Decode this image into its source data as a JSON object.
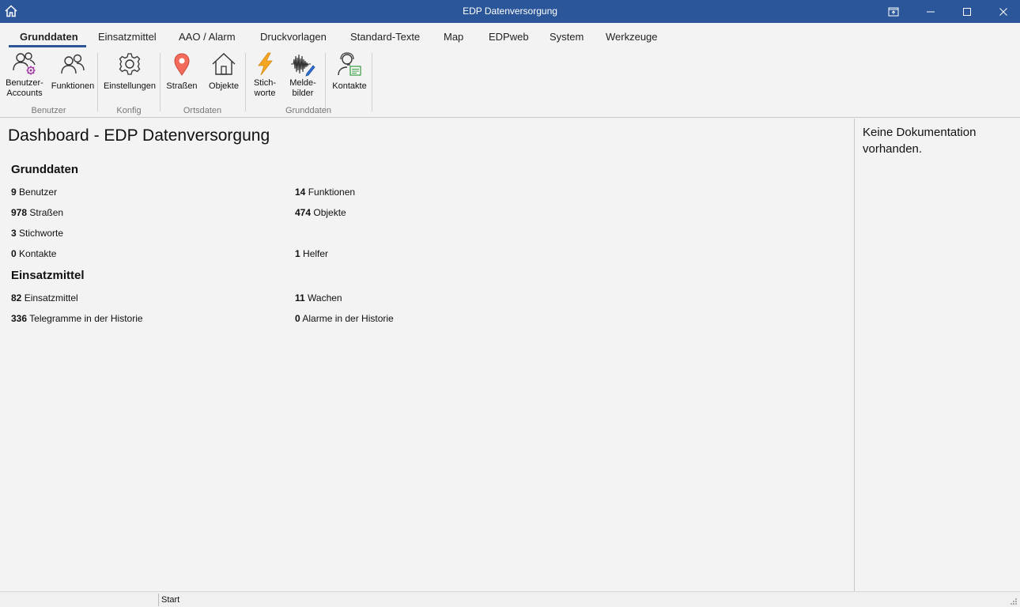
{
  "window": {
    "title": "EDP Datenversorgung"
  },
  "tabs": [
    {
      "label": "Grunddaten",
      "active": true
    },
    {
      "label": "Einsatzmittel"
    },
    {
      "label": "AAO / Alarm"
    },
    {
      "label": "Druckvorlagen"
    },
    {
      "label": "Standard-Texte"
    },
    {
      "label": "Map"
    },
    {
      "label": "EDPweb"
    },
    {
      "label": "System"
    },
    {
      "label": "Werkzeuge"
    }
  ],
  "ribbon": {
    "buttons": {
      "benutzer_accounts": {
        "line1": "Benutzer-",
        "line2": "Accounts",
        "icon": "users-gear-icon"
      },
      "funktionen": {
        "label": "Funktionen",
        "icon": "users-icon"
      },
      "einstellungen": {
        "label": "Einstellungen",
        "icon": "gear-icon"
      },
      "strassen": {
        "label": "Straßen",
        "icon": "map-pin-icon"
      },
      "objekte": {
        "label": "Objekte",
        "icon": "house-icon"
      },
      "stichworte": {
        "line1": "Stich-",
        "line2": "worte",
        "icon": "lightning-icon"
      },
      "meldebilder": {
        "line1": "Melde-",
        "line2": "bilder",
        "icon": "waveform-pen-icon"
      },
      "kontakte": {
        "label": "Kontakte",
        "icon": "headset-contact-icon"
      }
    },
    "groups": {
      "benutzer": "Benutzer",
      "konfig": "Konfig",
      "ortsdaten": "Ortsdaten",
      "grunddaten": "Grunddaten"
    }
  },
  "dashboard": {
    "title": "Dashboard - EDP Datenversorgung",
    "sections": {
      "grunddaten": {
        "title": "Grunddaten",
        "stats": {
          "benutzer": {
            "count": "9",
            "label": "Benutzer"
          },
          "funktionen": {
            "count": "14",
            "label": "Funktionen"
          },
          "strassen": {
            "count": "978",
            "label": "Straßen"
          },
          "objekte": {
            "count": "474",
            "label": "Objekte"
          },
          "stichworte": {
            "count": "3",
            "label": "Stichworte"
          },
          "kontakte": {
            "count": "0",
            "label": "Kontakte"
          },
          "helfer": {
            "count": "1",
            "label": "Helfer"
          }
        }
      },
      "einsatzmittel": {
        "title": "Einsatzmittel",
        "stats": {
          "einsatzmittel": {
            "count": "82",
            "label": "Einsatzmittel"
          },
          "wachen": {
            "count": "11",
            "label": "Wachen"
          },
          "telegramme": {
            "count": "336",
            "label": "Telegramme in der Historie"
          },
          "alarme": {
            "count": "0",
            "label": "Alarme in der Historie"
          }
        }
      }
    }
  },
  "documentation": {
    "text": "Keine Dokumentation vorhanden."
  },
  "statusbar": {
    "text": "Start"
  },
  "colors": {
    "titlebar": "#2b579a",
    "background": "#f3f3f3",
    "strassen_pin": "#f26b5b",
    "stichworte_bolt": "#f5a623"
  }
}
